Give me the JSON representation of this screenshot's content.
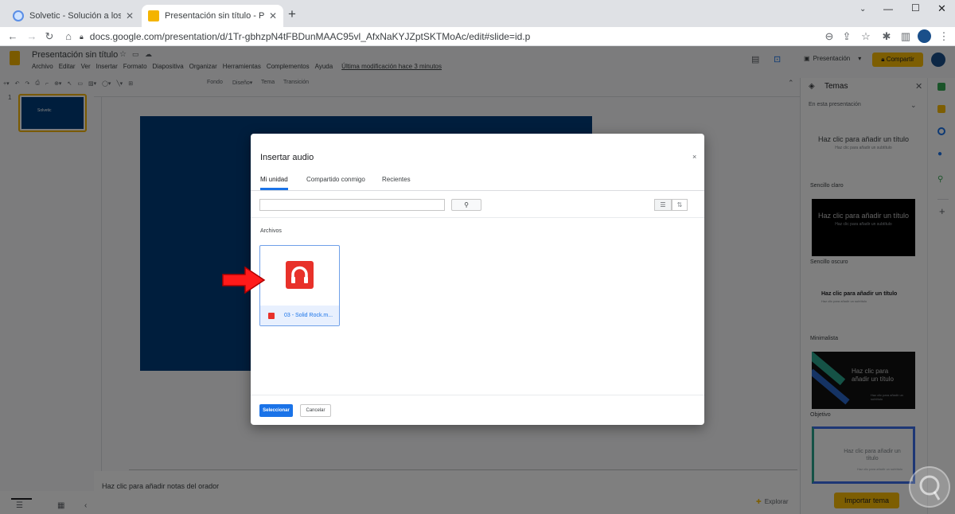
{
  "browser": {
    "tabs": [
      {
        "title": "Solvetic - Solución a los problem"
      },
      {
        "title": "Presentación sin título - Presenta"
      }
    ],
    "url": "docs.google.com/presentation/d/1Tr-gbhzpN4tFBDunMAAC95vl_AfxNaKYJZptSKTMoAc/edit#slide=id.p"
  },
  "app": {
    "doc_title": "Presentación sin título",
    "menu": [
      "Archivo",
      "Editar",
      "Ver",
      "Insertar",
      "Formato",
      "Diapositiva",
      "Organizar",
      "Herramientas",
      "Complementos",
      "Ayuda"
    ],
    "last_modified": "Última modificación hace 3 minutos",
    "present_label": "Presentación",
    "share_label": "Compartir",
    "toolbar": {
      "background": "Fondo",
      "layout": "Diseño",
      "theme": "Tema",
      "transition": "Transición"
    },
    "slide_number": "1",
    "thumb_text": "Solvetic",
    "speaker_notes": "Haz clic para añadir notas del orador",
    "explore_label": "Explorar"
  },
  "themes_panel": {
    "title": "Temas",
    "section": "En esta presentación",
    "import_label": "Importar tema",
    "placeholder_title": "Haz clic para añadir un título",
    "placeholder_title_split": "Haz clic para añadir un título",
    "placeholder_subtitle": "Haz clic para añadir un subtítulo",
    "names": [
      "Sencillo claro",
      "Sencillo oscuro",
      "Minimalista",
      "Objetivo"
    ]
  },
  "dialog": {
    "title": "Insertar audio",
    "close": "×",
    "tabs": [
      "Mi unidad",
      "Compartido conmigo",
      "Recientes"
    ],
    "section": "Archivos",
    "file_name": "03 - Solid Rock.m...",
    "select_label": "Seleccionar",
    "cancel_label": "Cancelar"
  },
  "colors": {
    "accent": "#1a73e8",
    "slide_bg": "#003d7a",
    "audio_red": "#e8312a",
    "share_yellow": "#fbbc04"
  }
}
